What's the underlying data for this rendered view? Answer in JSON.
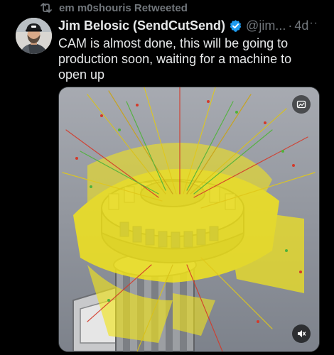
{
  "retweet": {
    "label": "em m0shouris Retweeted",
    "icon": "retweet-icon"
  },
  "tweet": {
    "author": {
      "display_name": "Jim Belosic (SendCutSend)",
      "handle": "@jim...",
      "verified": true,
      "verified_color": "#1d9bf0"
    },
    "separator": "·",
    "time": "4d",
    "more_label": "···",
    "text": "CAM is almost done, this will be going to production soon, waiting for a machine to open up",
    "media": {
      "type": "video",
      "controls": [
        "gif-icon",
        "mute-icon"
      ]
    }
  },
  "colors": {
    "background": "#000000",
    "text_primary": "#e7e9ea",
    "text_secondary": "#71767b",
    "toolpath_yellow": "#f2e41c",
    "part_blue": "#2e49c4"
  }
}
